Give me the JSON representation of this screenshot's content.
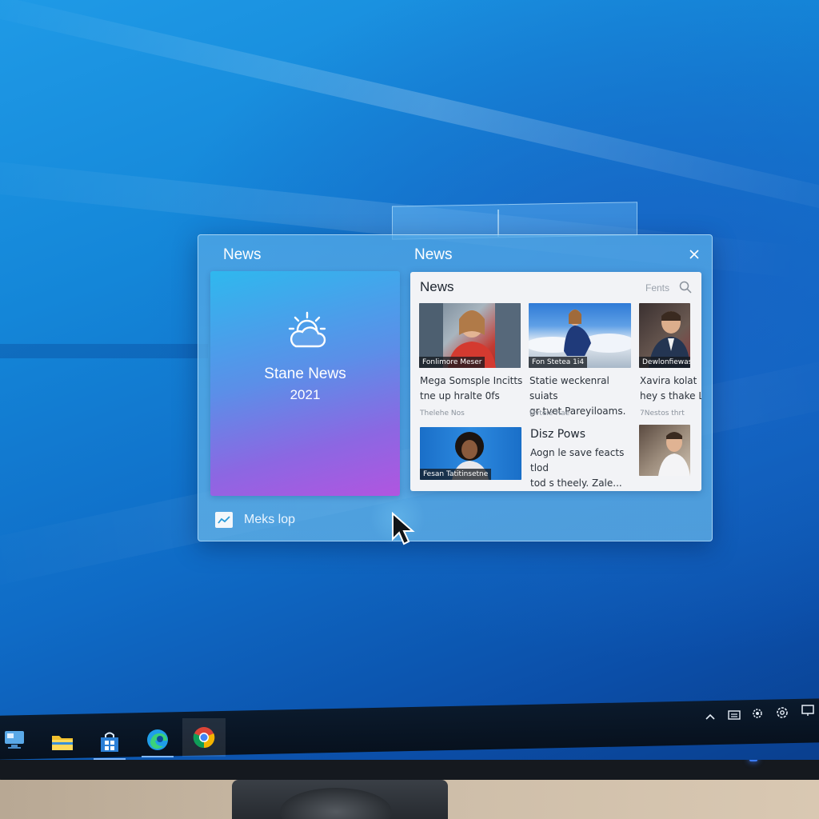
{
  "widget": {
    "title_left": "News",
    "title_right": "News",
    "close_icon": "close-icon"
  },
  "weather_tile": {
    "icon": "partly-cloudy-icon",
    "title": "Stane News",
    "year": "2021"
  },
  "footer": {
    "icon": "chart-icon",
    "label": "Meks lop"
  },
  "news_panel": {
    "header": "News",
    "filter_label": "Fents",
    "search_icon": "search-icon",
    "articles": [
      {
        "caption": "Fonlimore Meser",
        "headline_1": "Mega Somsple Incitts",
        "headline_2": "tne up hralte 0fs",
        "source": "Thelehe  Nos"
      },
      {
        "caption": "Fon Stetea  1i4",
        "headline_1": "Statie weckenral suiats",
        "headline_2": "gr tvet Pareyiloams.",
        "source": "Fivtele  Hae"
      },
      {
        "caption": "Dewlonfiewas",
        "headline_1": "Xavira kolat",
        "headline_2": "hey s thake L",
        "source": "7Nestos  thrt"
      },
      {
        "caption": "Fesan Tatitinsetne",
        "headline_1": "",
        "headline_2": "",
        "source": ""
      }
    ],
    "sub_heading": "Disz Pows",
    "sub_headline_1": "Aogn le save feacts tlod",
    "sub_headline_2": "tod s theely. Zale..."
  },
  "taskbar": {
    "apps": [
      {
        "name": "desktop-app",
        "icon": "computer-icon"
      },
      {
        "name": "file-explorer",
        "icon": "folder-icon"
      },
      {
        "name": "store-app",
        "icon": "store-icon"
      },
      {
        "name": "edge-browser",
        "icon": "edge-icon"
      },
      {
        "name": "chrome-browser",
        "icon": "chrome-icon"
      }
    ],
    "tray": [
      "chevron-up-icon",
      "keyboard-icon",
      "gear-icon",
      "settings-icon",
      "notification-icon"
    ]
  },
  "colors": {
    "accent": "#7fb8ff",
    "wallpaper": "#1486d8",
    "tile_start": "#2fb8ee",
    "tile_end": "#b155e0"
  }
}
